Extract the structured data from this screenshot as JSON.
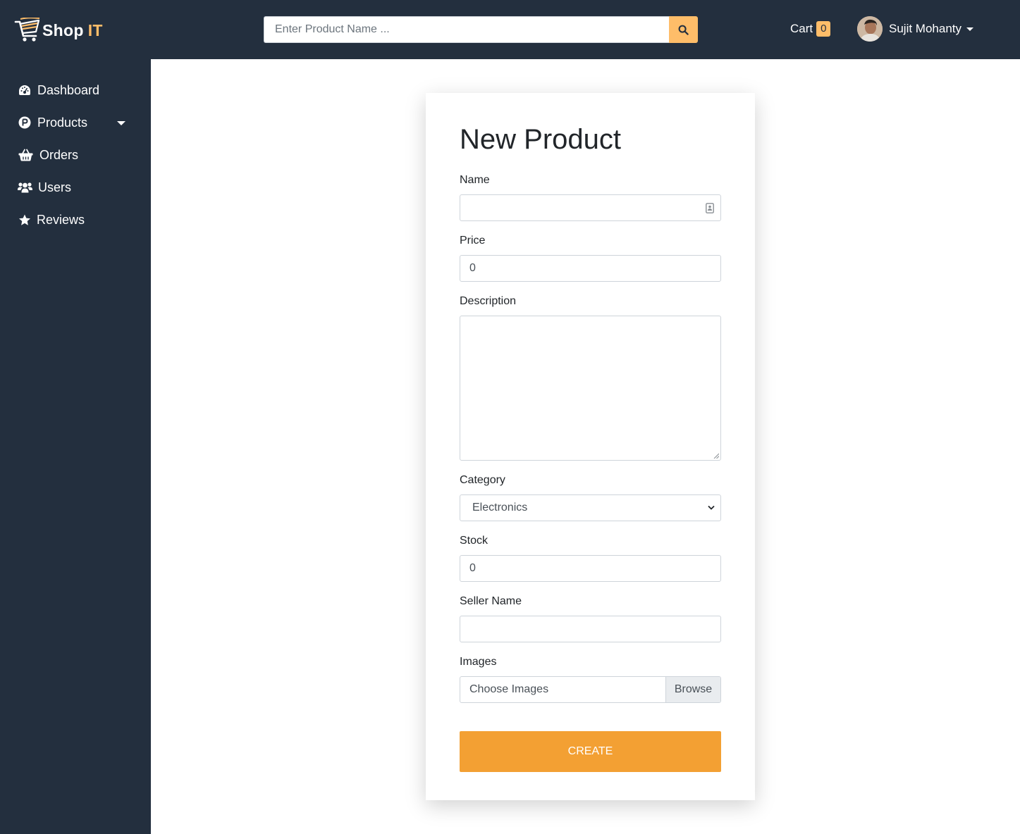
{
  "header": {
    "logo_text": "Shop",
    "logo_accent": "IT",
    "search_placeholder": "Enter Product Name ...",
    "cart_label": "Cart",
    "cart_count": "0",
    "user_name": "Sujit Mohanty"
  },
  "sidebar": {
    "items": [
      {
        "label": "Dashboard",
        "icon": "tachometer-icon"
      },
      {
        "label": "Products",
        "icon": "product-hunt-icon"
      },
      {
        "label": "Orders",
        "icon": "shopping-basket-icon"
      },
      {
        "label": "Users",
        "icon": "users-icon"
      },
      {
        "label": "Reviews",
        "icon": "star-icon"
      }
    ]
  },
  "form": {
    "title": "New Product",
    "name_label": "Name",
    "name_value": "",
    "price_label": "Price",
    "price_value": "0",
    "description_label": "Description",
    "description_value": "",
    "category_label": "Category",
    "category_value": "Electronics",
    "stock_label": "Stock",
    "stock_value": "0",
    "seller_label": "Seller Name",
    "seller_value": "",
    "images_label": "Images",
    "images_placeholder": "Choose Images",
    "browse_label": "Browse",
    "create_label": "CREATE"
  },
  "colors": {
    "navbar": "#232f3e",
    "accent": "#febd69",
    "create_button": "#f3a033"
  }
}
